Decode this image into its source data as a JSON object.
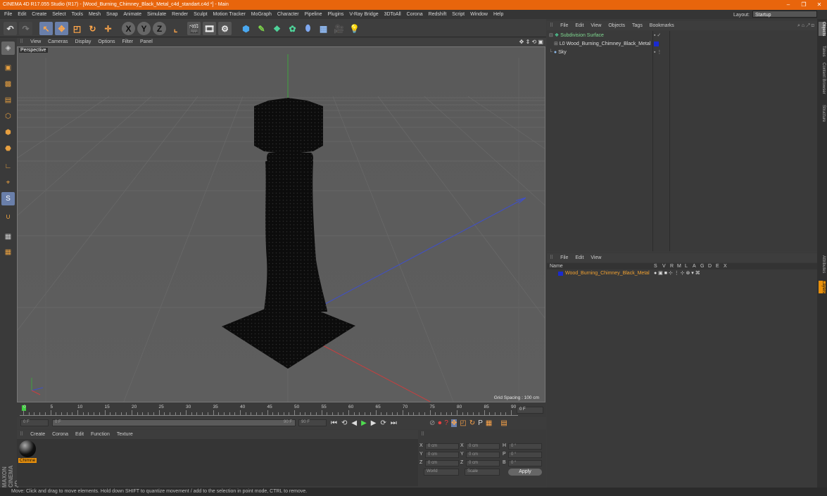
{
  "titlebar": {
    "title": "CINEMA 4D R17.055 Studio (R17) - [Wood_Burning_Chimney_Black_Metal_c4d_standart.c4d *] - Main",
    "min": "–",
    "max": "❐",
    "close": "✕"
  },
  "menu": [
    "File",
    "Edit",
    "Create",
    "Select",
    "Tools",
    "Mesh",
    "Snap",
    "Animate",
    "Simulate",
    "Render",
    "Sculpt",
    "Motion Tracker",
    "MoGraph",
    "Character",
    "Pipeline",
    "Plugins",
    "V-Ray Bridge",
    "3DToAll",
    "Corona",
    "Redshift",
    "Script",
    "Window",
    "Help"
  ],
  "layout": {
    "label": "Layout:",
    "value": "Startup"
  },
  "toolbar": {
    "x": "X",
    "y": "Y",
    "z": "Z"
  },
  "viewport": {
    "menu": [
      "View",
      "Cameras",
      "Display",
      "Options",
      "Filter",
      "Panel"
    ],
    "label": "Perspective",
    "grid_spacing": "Grid Spacing : 100 cm"
  },
  "timeline": {
    "ticks": [
      "0",
      "5",
      "10",
      "15",
      "20",
      "25",
      "30",
      "35",
      "40",
      "45",
      "50",
      "55",
      "60",
      "65",
      "70",
      "75",
      "80",
      "85",
      "90"
    ],
    "end_frame": "0 F"
  },
  "playbar": {
    "start": "0 F",
    "current": "0 F",
    "end_slider": "90 F",
    "end": "90 F"
  },
  "materials": {
    "menu": [
      "Create",
      "Corona",
      "Edit",
      "Function",
      "Texture"
    ],
    "item": "Chimne"
  },
  "coords": {
    "rows": [
      {
        "a": "X",
        "av": "0 cm",
        "b": "X",
        "bv": "0 cm",
        "c": "H",
        "cv": "0 °"
      },
      {
        "a": "Y",
        "av": "0 cm",
        "b": "Y",
        "bv": "0 cm",
        "c": "P",
        "cv": "0 °"
      },
      {
        "a": "Z",
        "av": "0 cm",
        "b": "Z",
        "bv": "0 cm",
        "c": "B",
        "cv": "0 °"
      }
    ],
    "world": "World",
    "scale": "Scale",
    "apply": "Apply"
  },
  "objects": {
    "menu": [
      "File",
      "Edit",
      "View",
      "Objects",
      "Tags",
      "Bookmarks"
    ],
    "items": [
      "Subdivision Surface",
      "Wood_Burning_Chimney_Black_Metal",
      "Sky"
    ]
  },
  "attributes": {
    "menu": [
      "File",
      "Edit",
      "View"
    ],
    "columns": [
      "Name",
      "S",
      "V",
      "R",
      "M",
      "L",
      "A",
      "G",
      "D",
      "E",
      "X"
    ],
    "item": "Wood_Burning_Chimney_Black_Metal"
  },
  "right_tabs": [
    "Objects",
    "Takes",
    "Content Browser",
    "Structure",
    "Attributes",
    "Layers"
  ],
  "brand": "MAXON CINEMA 4D",
  "status": "Move: Click and drag to move elements. Hold down SHIFT to quantize movement / add to the selection in point mode, CTRL to remove.",
  "colors": {
    "accent": "#e8650c",
    "selected_text": "#f0a030",
    "axis_y": "#3fa33f",
    "axis_z": "#3f4fc8",
    "axis_x": "#c83f3f"
  }
}
